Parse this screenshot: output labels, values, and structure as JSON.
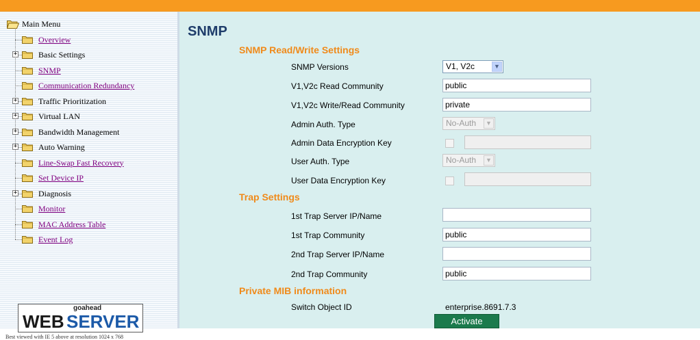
{
  "sidebar": {
    "items": [
      {
        "label": "Main Menu",
        "link": false,
        "expander": "",
        "top": 0,
        "root": true
      },
      {
        "label": "Overview",
        "link": true,
        "expander": ""
      },
      {
        "label": "Basic Settings",
        "link": false,
        "expander": "+"
      },
      {
        "label": "SNMP",
        "link": true,
        "expander": ""
      },
      {
        "label": "Communication Redundancy",
        "link": true,
        "expander": ""
      },
      {
        "label": "Traffic Prioritization",
        "link": false,
        "expander": "+"
      },
      {
        "label": "Virtual LAN",
        "link": false,
        "expander": "+"
      },
      {
        "label": "Bandwidth Management",
        "link": false,
        "expander": "+"
      },
      {
        "label": "Auto Warning",
        "link": false,
        "expander": "+"
      },
      {
        "label": "Line-Swap Fast Recovery",
        "link": true,
        "expander": ""
      },
      {
        "label": "Set Device IP",
        "link": true,
        "expander": ""
      },
      {
        "label": "Diagnosis",
        "link": false,
        "expander": "+"
      },
      {
        "label": "Monitor",
        "link": true,
        "expander": ""
      },
      {
        "label": "MAC Address Table",
        "link": true,
        "expander": ""
      },
      {
        "label": "Event Log",
        "link": true,
        "expander": ""
      }
    ],
    "logo": {
      "top_text": "goahead",
      "web": "WEB",
      "server": "SERVER"
    },
    "footnote": "Best viewed with IE 5 above at resolution 1024 x 768"
  },
  "main": {
    "title": "SNMP",
    "sections": {
      "rw": "SNMP Read/Write Settings",
      "trap": "Trap Settings",
      "mib": "Private MIB information"
    },
    "fields": {
      "snmp_versions": {
        "label": "SNMP Versions",
        "value": "V1, V2c"
      },
      "read_community": {
        "label": "V1,V2c Read Community",
        "value": "public"
      },
      "write_community": {
        "label": "V1,V2c Write/Read Community",
        "value": "private"
      },
      "admin_auth": {
        "label": "Admin Auth. Type",
        "value": "No-Auth"
      },
      "admin_key": {
        "label": "Admin Data Encryption Key",
        "value": ""
      },
      "user_auth": {
        "label": "User Auth. Type",
        "value": "No-Auth"
      },
      "user_key": {
        "label": "User Data Encryption Key",
        "value": ""
      },
      "trap1_server": {
        "label": "1st Trap Server IP/Name",
        "value": ""
      },
      "trap1_community": {
        "label": "1st Trap Community",
        "value": "public"
      },
      "trap2_server": {
        "label": "2nd Trap Server IP/Name",
        "value": ""
      },
      "trap2_community": {
        "label": "2nd Trap Community",
        "value": "public"
      },
      "object_id": {
        "label": "Switch Object ID",
        "value": "enterprise.8691.7.3"
      }
    },
    "activate_label": "Activate"
  },
  "colors": {
    "topbar": "#f79a1f",
    "section": "#f08a1a",
    "title": "#1f3d6b",
    "content_bg": "#d9efef",
    "button": "#1b7a4c"
  }
}
